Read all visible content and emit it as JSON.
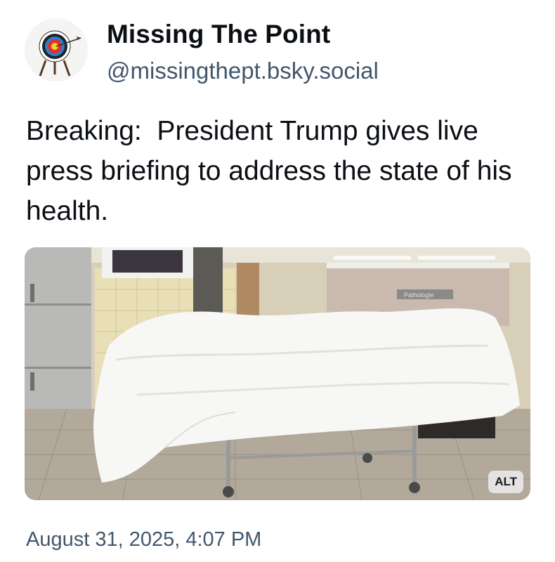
{
  "author": {
    "display_name": "Missing The Point",
    "handle": "@missingthept.bsky.social",
    "avatar_icon": "archery-target-icon"
  },
  "post": {
    "text": "Breaking:  President Trump gives live press briefing to address the state of his health.",
    "media": {
      "description": "hospital gurney covered by white sheet",
      "alt_badge": "ALT",
      "sign_text": "Pathologie"
    },
    "timestamp": "August 31, 2025, 4:07 PM"
  },
  "colors": {
    "text": "#0b0f14",
    "muted": "#42576c",
    "background": "#ffffff"
  }
}
